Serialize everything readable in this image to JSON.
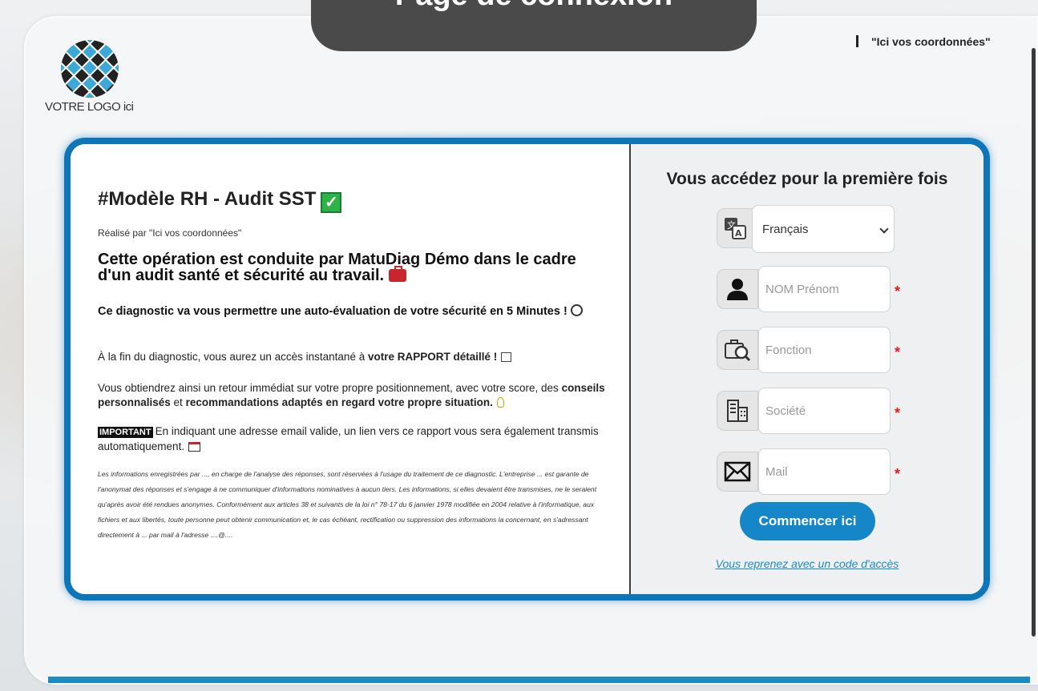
{
  "banner": {
    "title": "Page de connexion"
  },
  "logo": {
    "text": "VOTRE LOGO ici"
  },
  "header": {
    "contact": "\"Ici vos coordonnées\""
  },
  "left": {
    "title": "#Modèle RH - Audit SST",
    "by": "Réalisé par \"Ici vos coordonnées\"",
    "heading": "Cette opération est conduite par MatuDiag Démo dans le cadre d'un audit santé et sécurité au travail.",
    "subheading": "Ce diagnostic va vous permettre une auto-évaluation de votre sécurité en 5 Minutes !",
    "p1_start": "À la fin du diagnostic, vous aurez un accès instantané à ",
    "p1_bold": "votre RAPPORT détaillé !",
    "p2_start": "Vous obtiendrez ainsi un retour immédiat sur votre propre positionnement, avec votre score, des ",
    "p2_bold1": "conseils personnalisés",
    "p2_mid": " et ",
    "p2_bold2": "recommandations adaptés en regard votre propre situation.",
    "important_label": "IMPORTANT",
    "p3": "En indiquant une adresse email valide, un lien vers ce rapport vous sera également transmis automatiquement.",
    "legal": "Les informations enregistrées par ..., en charge de l'analyse des réponses, sont réservées à l'usage du traitement de ce diagnostic. L'entreprise ... est garante de l'anonymat des réponses et s'engage à ne communiquer d'informations nominatives à aucun tiers. Les informations, si elles devaient être transmises, ne le seraient qu'après avoir été rendues anonymes. Conformément aux articles 38 et suivants de la loi n° 78-17 du 6 janvier 1978 modifiée en 2004 relative à l'informatique, aux fichiers et aux libertés, toute personne peut obtenir communication et, le cas échéant, rectification ou suppression des informations la concernant, en s'adressant directement à ... par mail à l'adresse ....@...."
  },
  "form": {
    "title": "Vous accédez pour la première fois",
    "language": "Français",
    "name_placeholder": "NOM Prénom",
    "function_placeholder": "Fonction",
    "company_placeholder": "Société",
    "mail_placeholder": "Mail",
    "required_mark": "*",
    "submit_label": "Commencer ici",
    "access_code_link": "Vous reprenez avec un code d'accès"
  },
  "colors": {
    "accent": "#1587c9",
    "border": "#0d76b8",
    "required": "#e21b1b",
    "banner": "#4a4a4a"
  }
}
